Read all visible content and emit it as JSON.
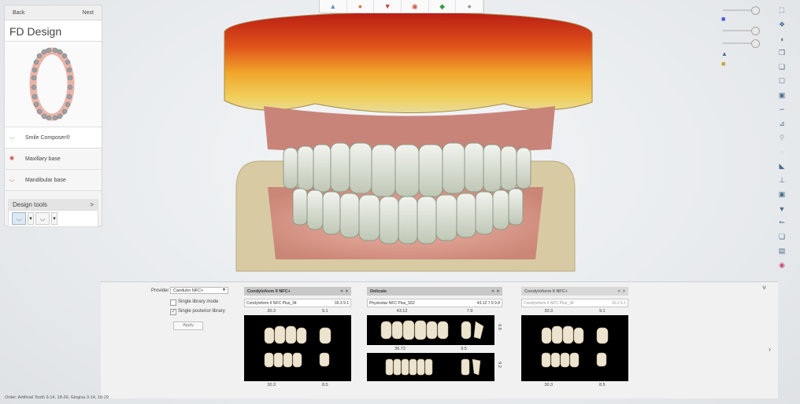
{
  "nav": {
    "back_label": "Back",
    "next_label": "Next"
  },
  "panel_title": "FD Design",
  "menu": {
    "items": [
      {
        "label": "Smile Composer®"
      },
      {
        "label": "Maxillary base"
      },
      {
        "label": "Mandibular base"
      }
    ]
  },
  "design_tools": {
    "label": "Design tools",
    "chevron": ">"
  },
  "bottom": {
    "provider_label": "Provider",
    "provider_value": "Candulor NFC+",
    "single_library_label": "Single library mode",
    "single_posterior_label": "Single posterior library",
    "single_posterior_checked": "✓",
    "apply_label": "Apply",
    "collapse_icon": "˅",
    "expand_icon": "›"
  },
  "columns": [
    {
      "title": "Condyloform II NFC+",
      "nav_prev": "<",
      "nav_next": ">",
      "select_value": "Condyloform II NFC Plus_34",
      "select_nums": "30.3  9.1",
      "top_nums": [
        "30.3",
        "9.1"
      ],
      "bottom_nums": [
        "30.3",
        "8.5"
      ]
    },
    {
      "title": "Delicate",
      "nav_prev": "<",
      "nav_next": ">",
      "select_value": "Physiostar NFC Plus_S52",
      "select_nums": "43.12  7.9  9.8",
      "top_nums": [
        "43.12",
        "7.9"
      ],
      "mid_nums": [
        "36.72",
        "9.5"
      ],
      "side_num_top": "9.8",
      "side_num_bottom": "9.2"
    },
    {
      "title": "Condyloform II NFC+",
      "nav_prev": "<",
      "nav_next": ">",
      "select_value": "Condyloform II NFC Plus_34",
      "select_nums": "30.3  9.1",
      "top_nums": [
        "30.3",
        "9.1"
      ],
      "bottom_nums": [
        "30.3",
        "8.5"
      ]
    }
  ],
  "status_text": "Order:  Artificial Tooth 3-14, 18-29, Gingiva 3-14, 18-29",
  "colors": {
    "accent": "#2b6aa8",
    "gingiva": "#e8a69a",
    "teeth": "#d9ddd2",
    "base": "#d8cba3"
  }
}
